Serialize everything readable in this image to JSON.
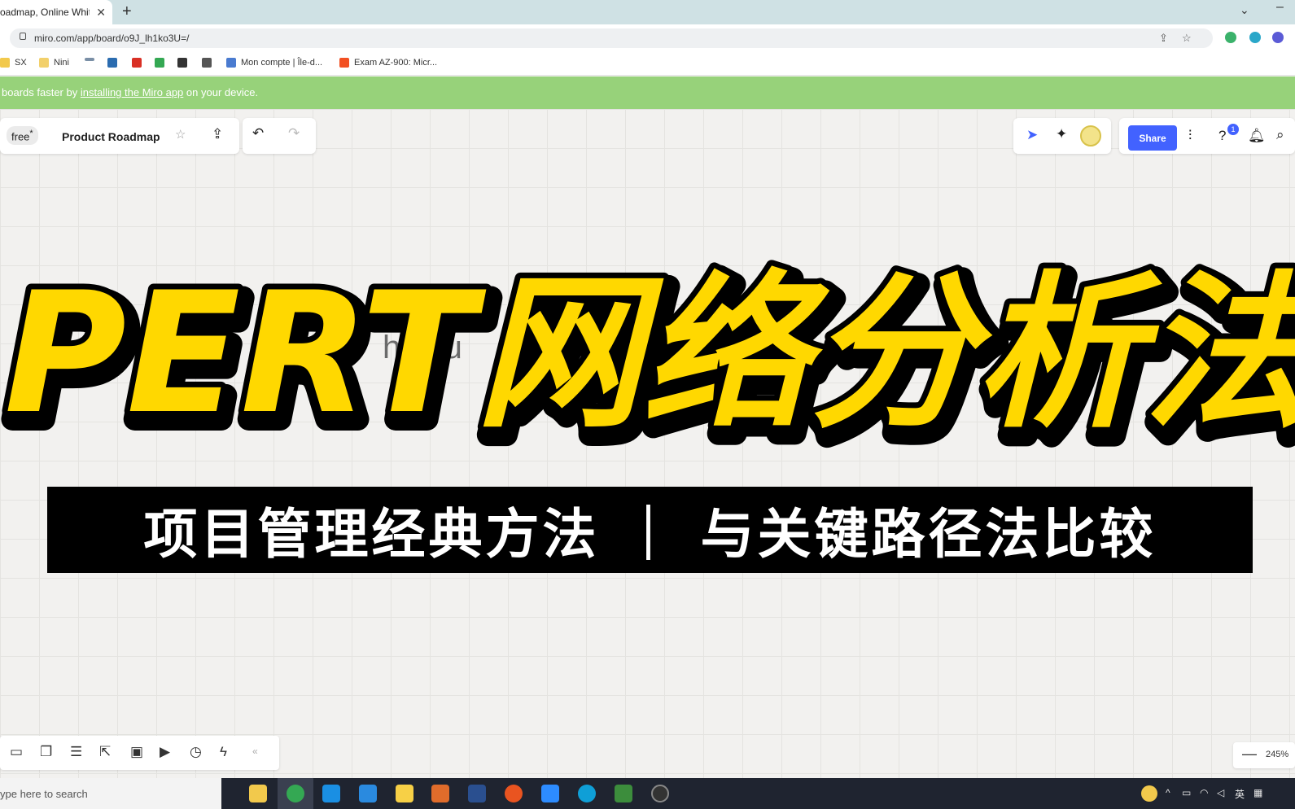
{
  "browser": {
    "tab_title": "oadmap, Online White",
    "tab_close": "✕",
    "new_tab": "+",
    "url": "miro.com/app/board/o9J_lh1ko3U=/",
    "bookmarks": [
      {
        "label": "SX",
        "color": "#f2c94c"
      },
      {
        "label": "Nini",
        "color": "#f2d06b"
      },
      {
        "label": "",
        "color": "#7a8fa6"
      },
      {
        "label": "",
        "color": "#2b6cb0"
      },
      {
        "label": "",
        "color": "#d93025"
      },
      {
        "label": "",
        "color": "#34a853"
      },
      {
        "label": "",
        "color": "#333333"
      },
      {
        "label": "",
        "color": "#555555"
      },
      {
        "label": "Mon compte | Île-d...",
        "color": "#4a7bd0"
      },
      {
        "label": "Exam AZ-900: Micr...",
        "color": "#f25022"
      }
    ]
  },
  "banner": {
    "prefix": "boards faster by ",
    "link": "installing the Miro app",
    "suffix": " on your device."
  },
  "board": {
    "plan_badge": "free",
    "plan_star": "*",
    "title": "Product Roadmap",
    "share_label": "Share",
    "notification_count": "1",
    "ghost_text": "hnc                    u",
    "zoom_level": "245%",
    "zoom_minus": "—"
  },
  "overlay": {
    "headline": "PERT网络分析法",
    "subtitle": "项目管理经典方法 ｜ 与关键路径法比较",
    "headline_fill": "#ffd800",
    "headline_outline": "#000000",
    "subtitle_bg": "#000000",
    "subtitle_color": "#ffffff"
  },
  "taskbar": {
    "search_placeholder": "ype here to search",
    "apps": [
      "file-explorer",
      "chrome",
      "search-app",
      "vscode",
      "sticky-notes",
      "matlab",
      "powershell",
      "ubuntu",
      "zoom",
      "edge",
      "photos",
      "obs"
    ],
    "tray_lang": "英"
  },
  "colors": {
    "accent": "#4262ff",
    "banner": "#97d27a",
    "tabbar": "#cfe1e4",
    "taskbar": "#1f2430"
  }
}
